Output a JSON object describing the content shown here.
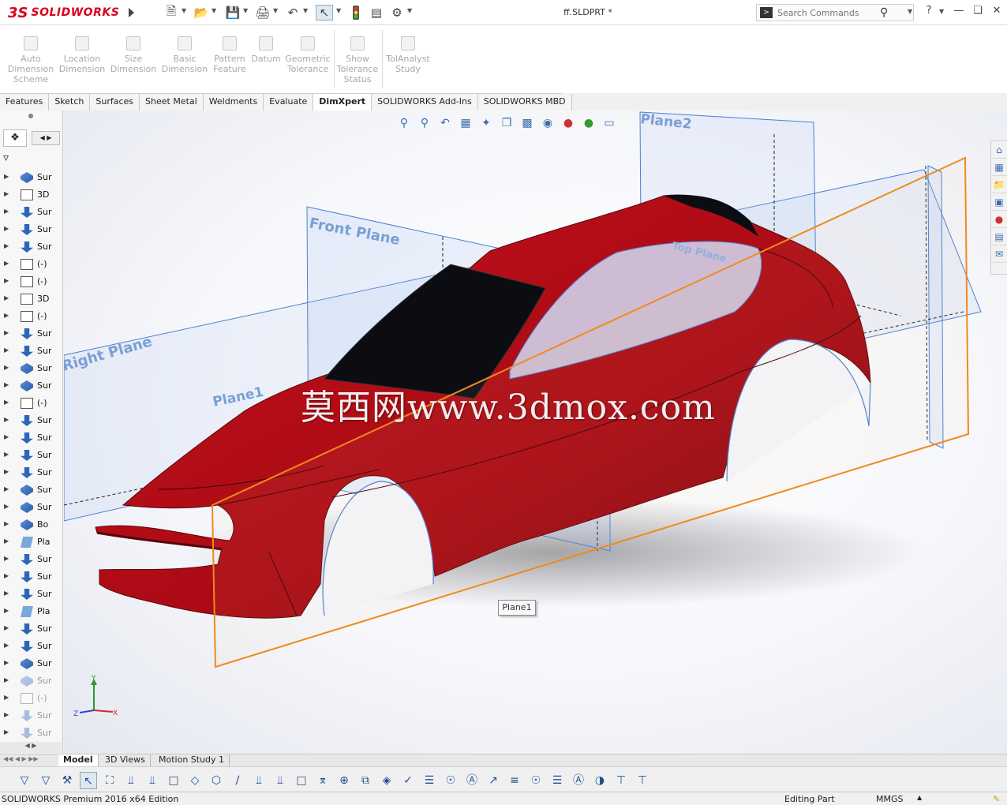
{
  "app": {
    "brand_ds": "3S",
    "brand_name": "SOLIDWORKS",
    "document_title": "ff.SLDPRT *"
  },
  "search": {
    "placeholder": "Search Commands"
  },
  "command_manager": {
    "buttons": [
      {
        "line1": "Auto",
        "line2": "Dimension",
        "line3": "Scheme"
      },
      {
        "line1": "Location",
        "line2": "Dimension",
        "line3": ""
      },
      {
        "line1": "Size",
        "line2": "Dimension",
        "line3": ""
      },
      {
        "line1": "Basic",
        "line2": "Dimension",
        "line3": ""
      },
      {
        "line1": "Pattern",
        "line2": "Feature",
        "line3": ""
      },
      {
        "line1": "Datum",
        "line2": "",
        "line3": ""
      },
      {
        "line1": "Geometric",
        "line2": "Tolerance",
        "line3": ""
      },
      {
        "line1": "Show",
        "line2": "Tolerance",
        "line3": "Status"
      },
      {
        "line1": "TolAnalyst",
        "line2": "Study",
        "line3": ""
      }
    ]
  },
  "tabs": [
    "Features",
    "Sketch",
    "Surfaces",
    "Sheet Metal",
    "Weldments",
    "Evaluate",
    "DimXpert",
    "SOLIDWORKS Add-Ins",
    "SOLIDWORKS MBD"
  ],
  "active_tab": "DimXpert",
  "feature_tree": [
    {
      "icon": "surface",
      "label": "Sur"
    },
    {
      "icon": "sketch3d",
      "label": "3D"
    },
    {
      "icon": "down",
      "label": "Sur"
    },
    {
      "icon": "down",
      "label": "Sur"
    },
    {
      "icon": "down",
      "label": "Sur"
    },
    {
      "icon": "sketch",
      "label": "(-)"
    },
    {
      "icon": "sketch",
      "label": "(-)"
    },
    {
      "icon": "sketch3d",
      "label": "3D"
    },
    {
      "icon": "sketch",
      "label": "(-)"
    },
    {
      "icon": "down",
      "label": "Sur"
    },
    {
      "icon": "down",
      "label": "Sur"
    },
    {
      "icon": "surface",
      "label": "Sur"
    },
    {
      "icon": "surface",
      "label": "Sur"
    },
    {
      "icon": "sketch",
      "label": "(-)"
    },
    {
      "icon": "down",
      "label": "Sur"
    },
    {
      "icon": "down",
      "label": "Sur"
    },
    {
      "icon": "down",
      "label": "Sur"
    },
    {
      "icon": "down",
      "label": "Sur"
    },
    {
      "icon": "surface",
      "label": "Sur"
    },
    {
      "icon": "surface",
      "label": "Sur"
    },
    {
      "icon": "surface",
      "label": "Bo"
    },
    {
      "icon": "plane",
      "label": "Pla"
    },
    {
      "icon": "down",
      "label": "Sur"
    },
    {
      "icon": "down",
      "label": "Sur"
    },
    {
      "icon": "down",
      "label": "Sur"
    },
    {
      "icon": "plane",
      "label": "Pla"
    },
    {
      "icon": "down",
      "label": "Sur"
    },
    {
      "icon": "down",
      "label": "Sur"
    },
    {
      "icon": "surface",
      "label": "Sur"
    },
    {
      "icon": "surface",
      "label": "Sur",
      "greyed": true
    },
    {
      "icon": "sketch3d",
      "label": "(-)",
      "greyed": true
    },
    {
      "icon": "down",
      "label": "Sur",
      "greyed": true
    },
    {
      "icon": "down",
      "label": "Sur",
      "greyed": true
    }
  ],
  "viewport": {
    "planes": {
      "front": "Front Plane",
      "right": "Right Plane",
      "top": "Top Plane",
      "plane1": "Plane1",
      "plane2": "Plane2"
    },
    "selected_tag": "Plane1",
    "watermark": "莫西网www.3dmox.com",
    "triad": {
      "x": "X",
      "y": "Y",
      "z": "Z"
    }
  },
  "bottom_tabs": [
    "Model",
    "3D Views",
    "Motion Study 1"
  ],
  "active_bottom_tab": "Model",
  "status": {
    "edition": "SOLIDWORKS Premium 2016 x64 Edition",
    "mode": "Editing Part",
    "units": "MMGS"
  },
  "colors": {
    "body_red": "#b80d17",
    "plane_blue": "#4a7fd4",
    "selected_plane": "#f08a1c",
    "brand_red": "#d9001b"
  }
}
